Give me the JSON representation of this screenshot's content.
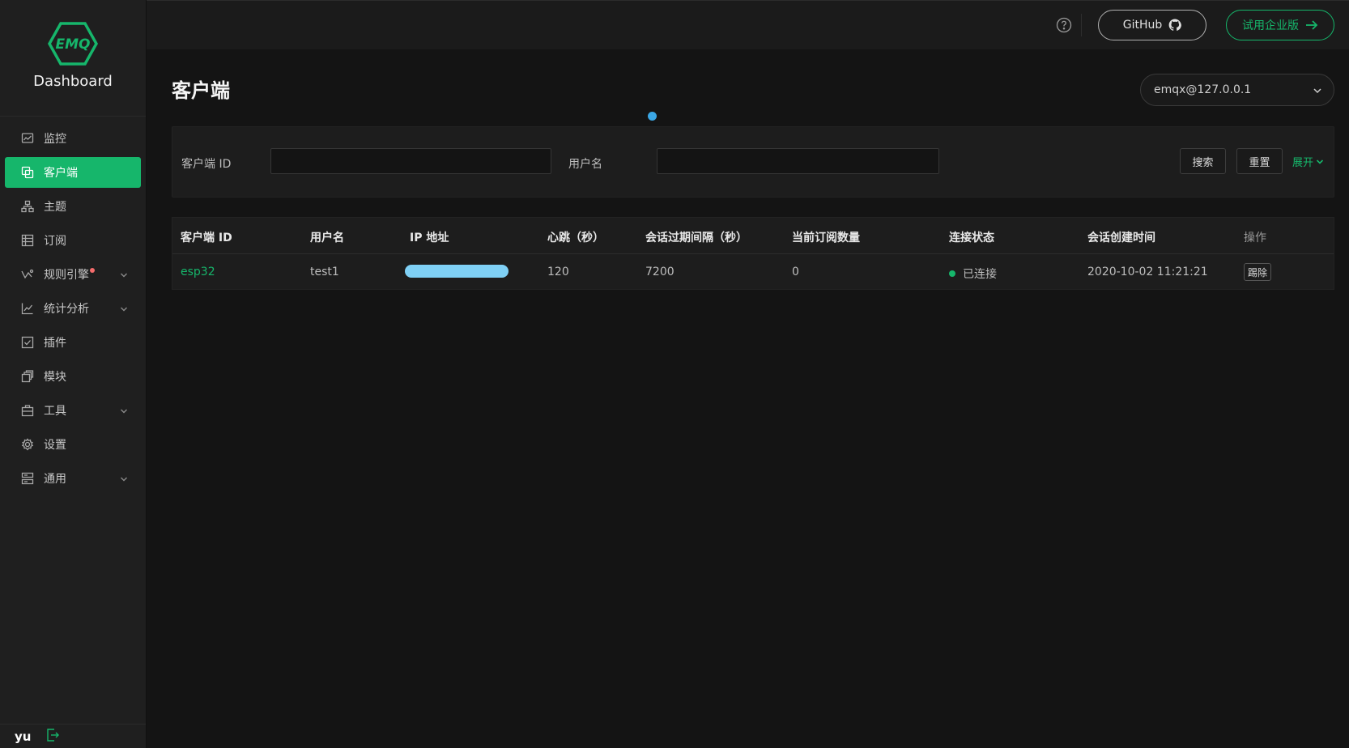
{
  "app": {
    "title": "Dashboard",
    "logo_text": "EMQ"
  },
  "sidebar": {
    "items": [
      {
        "label": "监控",
        "icon": "monitor-icon"
      },
      {
        "label": "客户端",
        "icon": "clients-icon",
        "active": true
      },
      {
        "label": "主题",
        "icon": "topics-icon"
      },
      {
        "label": "订阅",
        "icon": "subscriptions-icon"
      },
      {
        "label": "规则引擎",
        "icon": "rule-engine-icon",
        "badge": "red-dot",
        "expandable": true
      },
      {
        "label": "统计分析",
        "icon": "analytics-icon",
        "expandable": true
      },
      {
        "label": "插件",
        "icon": "plugins-icon"
      },
      {
        "label": "模块",
        "icon": "modules-icon"
      },
      {
        "label": "工具",
        "icon": "tools-icon",
        "expandable": true
      },
      {
        "label": "设置",
        "icon": "settings-icon"
      },
      {
        "label": "通用",
        "icon": "general-icon",
        "expandable": true
      }
    ],
    "user": "yu"
  },
  "topbar": {
    "github_label": "GitHub",
    "trial_label": "试用企业版"
  },
  "page": {
    "title": "客户端",
    "node_select": "emqx@127.0.0.1"
  },
  "filters": {
    "client_id_label": "客户端 ID",
    "client_id_value": "",
    "username_label": "用户名",
    "username_value": "",
    "search_label": "搜索",
    "reset_label": "重置",
    "expand_label": "展开"
  },
  "table": {
    "headers": [
      "客户端 ID",
      "用户名",
      "IP 地址",
      "心跳（秒）",
      "会话过期间隔（秒）",
      "当前订阅数量",
      "连接状态",
      "会话创建时间",
      "操作"
    ],
    "rows": [
      {
        "client_id": "esp32",
        "username": "test1",
        "ip": "",
        "keepalive": "120",
        "expiry": "7200",
        "subscriptions": "0",
        "status": "已连接",
        "created_at": "2020-10-02 11:21:21",
        "action": "踢除"
      }
    ]
  },
  "colors": {
    "accent": "#16b66b",
    "background": "#141414",
    "sidebar": "#1f1f1f",
    "loading_dot": "#3ba7e5",
    "redaction": "#7fd0f5"
  }
}
